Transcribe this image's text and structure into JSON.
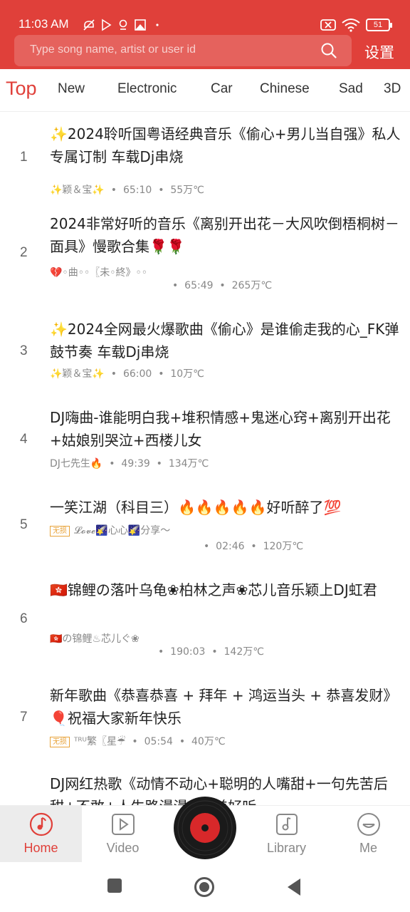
{
  "status": {
    "time": "11:03 AM",
    "battery": "51"
  },
  "search": {
    "placeholder": "Type song name, artist or user id"
  },
  "header": {
    "settings_label": "设置"
  },
  "tabs": [
    "Top",
    "New",
    "Electronic",
    "Car",
    "Chinese",
    "Sad",
    "3D"
  ],
  "playlist": [
    {
      "index": "1",
      "title": "✨2024聆听国粤语经典音乐《偷心+男儿当自强》私人专属订制  车载Dj串烧",
      "author": "✨颖＆宝✨",
      "duration": "65:10",
      "plays": "55万℃"
    },
    {
      "index": "2",
      "title": "2024非常好听的音乐《离别开出花－大风吹倒梧桐树－面具》慢歌合集🌹🌹",
      "author": "💔◦曲◦◦〖未◦終》◦◦",
      "duration": "65:49",
      "plays": "265万℃"
    },
    {
      "index": "3",
      "title": "✨2024全网最火爆歌曲《偷心》是谁偷走我的心_FK弹鼓节奏  车载Dj串烧",
      "author": "✨颖＆宝✨",
      "duration": "66:00",
      "plays": "10万℃"
    },
    {
      "index": "4",
      "title": "DJ嗨曲-谁能明白我+堆积情感+鬼迷心窍+离别开出花+姑娘别哭泣+西楼儿女",
      "author": "DJ七先生🔥",
      "duration": "49:39",
      "plays": "134万℃"
    },
    {
      "index": "5",
      "title": "一笑江湖（科目三）🔥🔥🔥🔥🔥好听醉了💯",
      "badge": "无损",
      "author": "𝓛𝓸𝓿𝓮🌠心心🌠分享〜",
      "duration": "02:46",
      "plays": "120万℃"
    },
    {
      "index": "6",
      "title": "🇭🇰锦鲤の落叶乌龟❀柏林之声❀芯儿音乐颖上DJ虹君",
      "author": "🇭🇰の锦鲤♨芯儿ぐ❀",
      "duration": "190:03",
      "plays": "142万℃"
    },
    {
      "index": "7",
      "title": "新年歌曲《恭喜恭喜 + 拜年 + 鸿运当头 + 恭喜发财》🎈祝福大家新年快乐",
      "badge": "无损",
      "author": "ᵀᴿᵁ繁〖星☔",
      "duration": "05:54",
      "plays": "40万℃"
    },
    {
      "index": "",
      "title": "DJ网红热歌《动情不动心+聪明的人嘴甜+一句先苦后甜+不敢+人生路漫漫+美美好听",
      "author": "",
      "duration": "",
      "plays": ""
    }
  ],
  "bottom_nav": [
    "Home",
    "Video",
    "Library",
    "Me"
  ],
  "colors": {
    "accent": "#e0403a",
    "header_bg": "#e0403a",
    "active_nav_bg": "#ececec"
  }
}
